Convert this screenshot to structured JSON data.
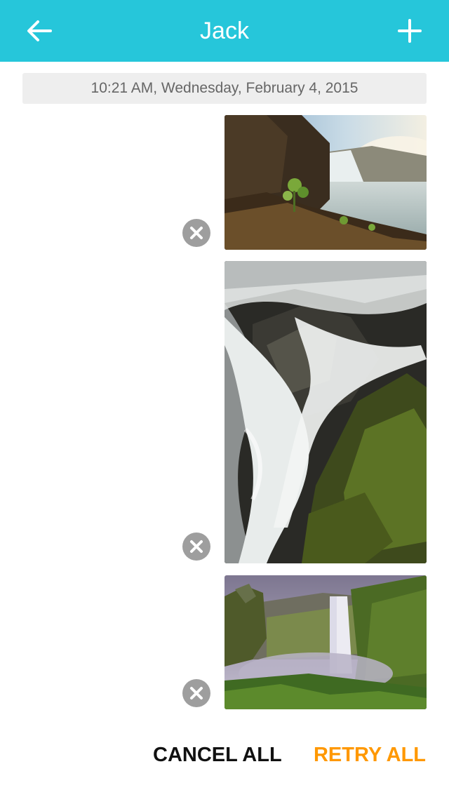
{
  "header": {
    "title": "Jack",
    "back_icon": "arrow-left-icon",
    "add_icon": "plus-icon",
    "color": "#26c6da"
  },
  "timestamp": "10:21 AM, Wednesday, February 4, 2015",
  "messages": [
    {
      "type": "photo",
      "subject": "waterfall landscape with rocks and plants",
      "status": "failed"
    },
    {
      "type": "photo",
      "subject": "long-exposure waterfall over mossy rocks",
      "status": "failed"
    },
    {
      "type": "photo",
      "subject": "waterfall in green valley with mist",
      "status": "failed"
    }
  ],
  "actions": {
    "cancel_all": "CANCEL ALL",
    "retry_all": "RETRY ALL",
    "retry_color": "#ff9800"
  }
}
